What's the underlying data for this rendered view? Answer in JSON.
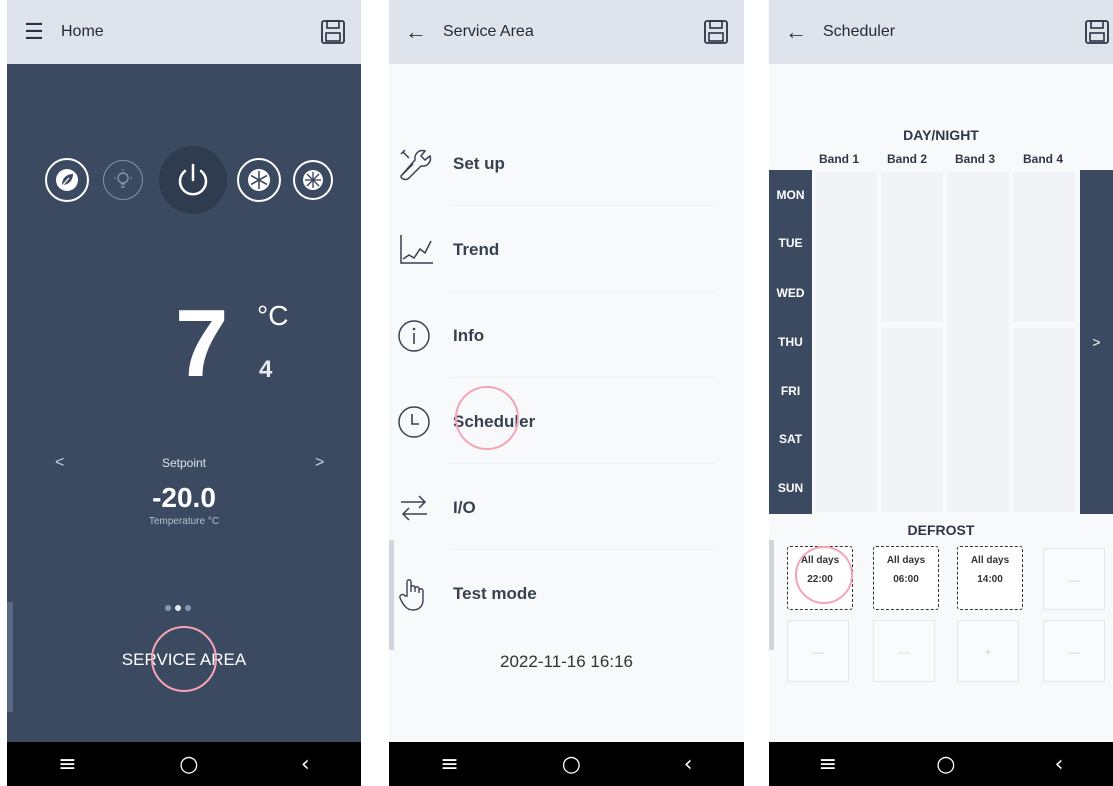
{
  "home": {
    "title": "Home",
    "temperature_int": "7",
    "temperature_unit": "°C",
    "temperature_dec": "4",
    "setpoint_label": "Setpoint",
    "setpoint_value": "-20.0",
    "setpoint_unit": "Temperature °C",
    "service_area": "SERVICE AREA",
    "modes": [
      "eco-icon",
      "light-icon",
      "power-icon",
      "defrost-icon",
      "fan-icon"
    ],
    "prev": "<",
    "next": ">"
  },
  "service": {
    "title": "Service Area",
    "items": [
      {
        "label": "Set up",
        "icon": "tools-icon"
      },
      {
        "label": "Trend",
        "icon": "trend-chart-icon"
      },
      {
        "label": "Info",
        "icon": "info-icon"
      },
      {
        "label": "Scheduler",
        "icon": "clock-icon"
      },
      {
        "label": "I/O",
        "icon": "swap-arrows-icon"
      },
      {
        "label": "Test mode",
        "icon": "hand-pointer-icon"
      }
    ],
    "datetime": "2022-11-16 16:16"
  },
  "scheduler": {
    "title": "Scheduler",
    "day_night_title": "DAY/NIGHT",
    "bands": [
      "Band 1",
      "Band 2",
      "Band 3",
      "Band 4"
    ],
    "days": [
      "MON",
      "TUE",
      "WED",
      "THU",
      "FRI",
      "SAT",
      "SUN"
    ],
    "next": ">",
    "defrost_title": "DEFROST",
    "defrost": [
      {
        "days": "All days",
        "time": "22:00"
      },
      {
        "days": "All days",
        "time": "06:00"
      },
      {
        "days": "All days",
        "time": "14:00"
      }
    ],
    "empty_marker": "—",
    "add_marker": "+"
  },
  "nav": {
    "menu": "≡",
    "home": "○",
    "back": "‹"
  },
  "colors": {
    "panel": "#3b4a61",
    "appbar": "#dfe3ec",
    "tap_ring": "#f7a3b5"
  }
}
